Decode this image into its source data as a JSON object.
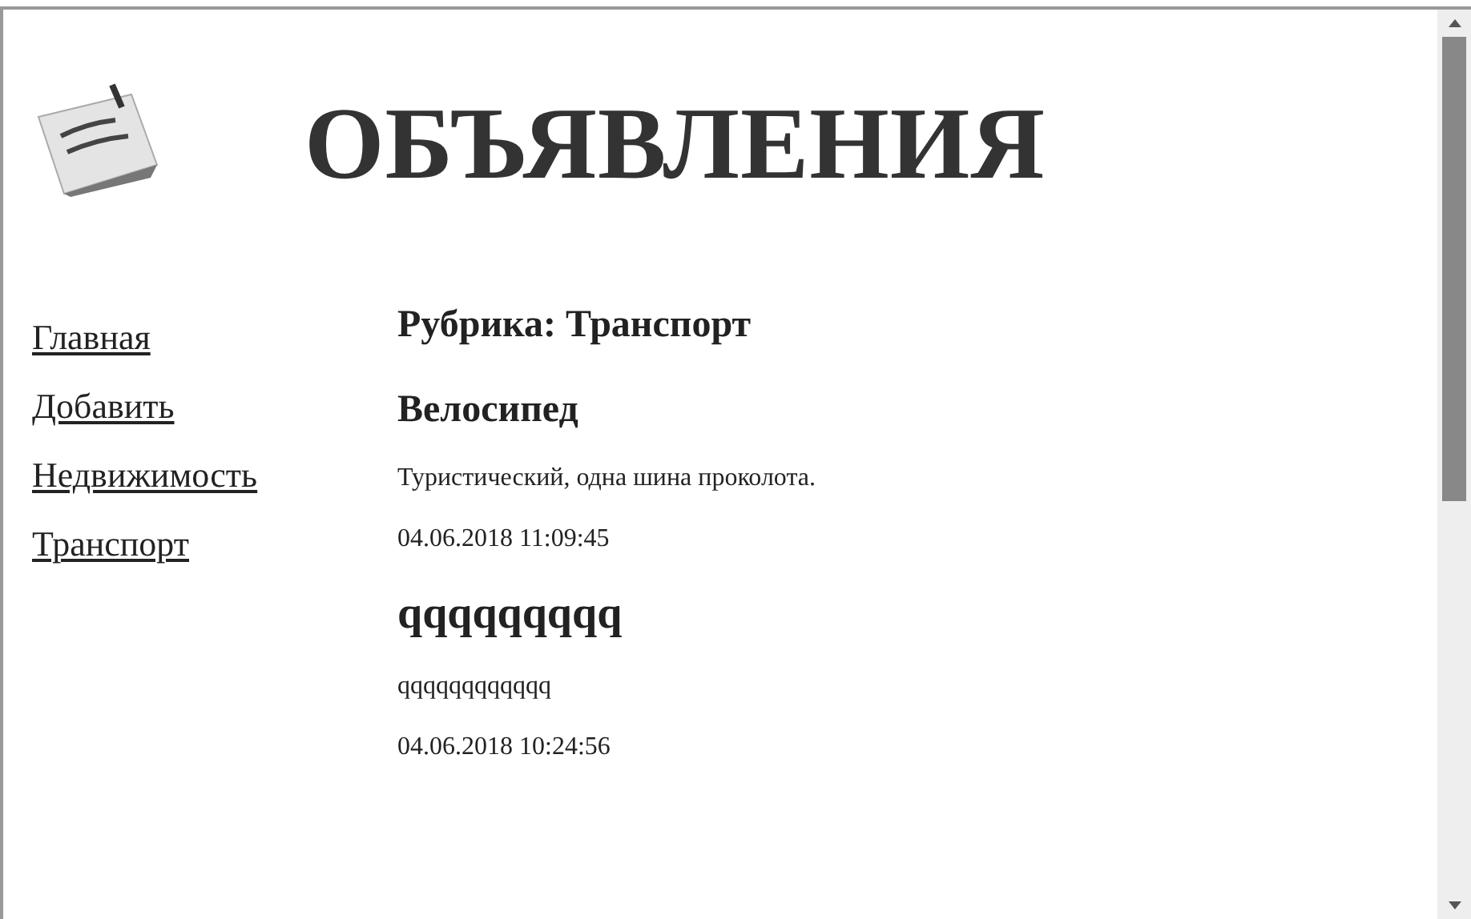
{
  "header": {
    "title": "ОБЪЯВЛЕНИЯ"
  },
  "nav": [
    {
      "label": "Главная"
    },
    {
      "label": "Добавить"
    },
    {
      "label": "Недвижимость"
    },
    {
      "label": "Транспорт"
    }
  ],
  "rubric": "Рубрика: Транспорт",
  "ads": [
    {
      "title": "Велосипед",
      "text": "Туристический, одна шина проколота.",
      "date": "04.06.2018 11:09:45"
    },
    {
      "title": "qqqqqqqqq",
      "text": "qqqqqqqqqqqq",
      "date": "04.06.2018 10:24:56"
    }
  ]
}
